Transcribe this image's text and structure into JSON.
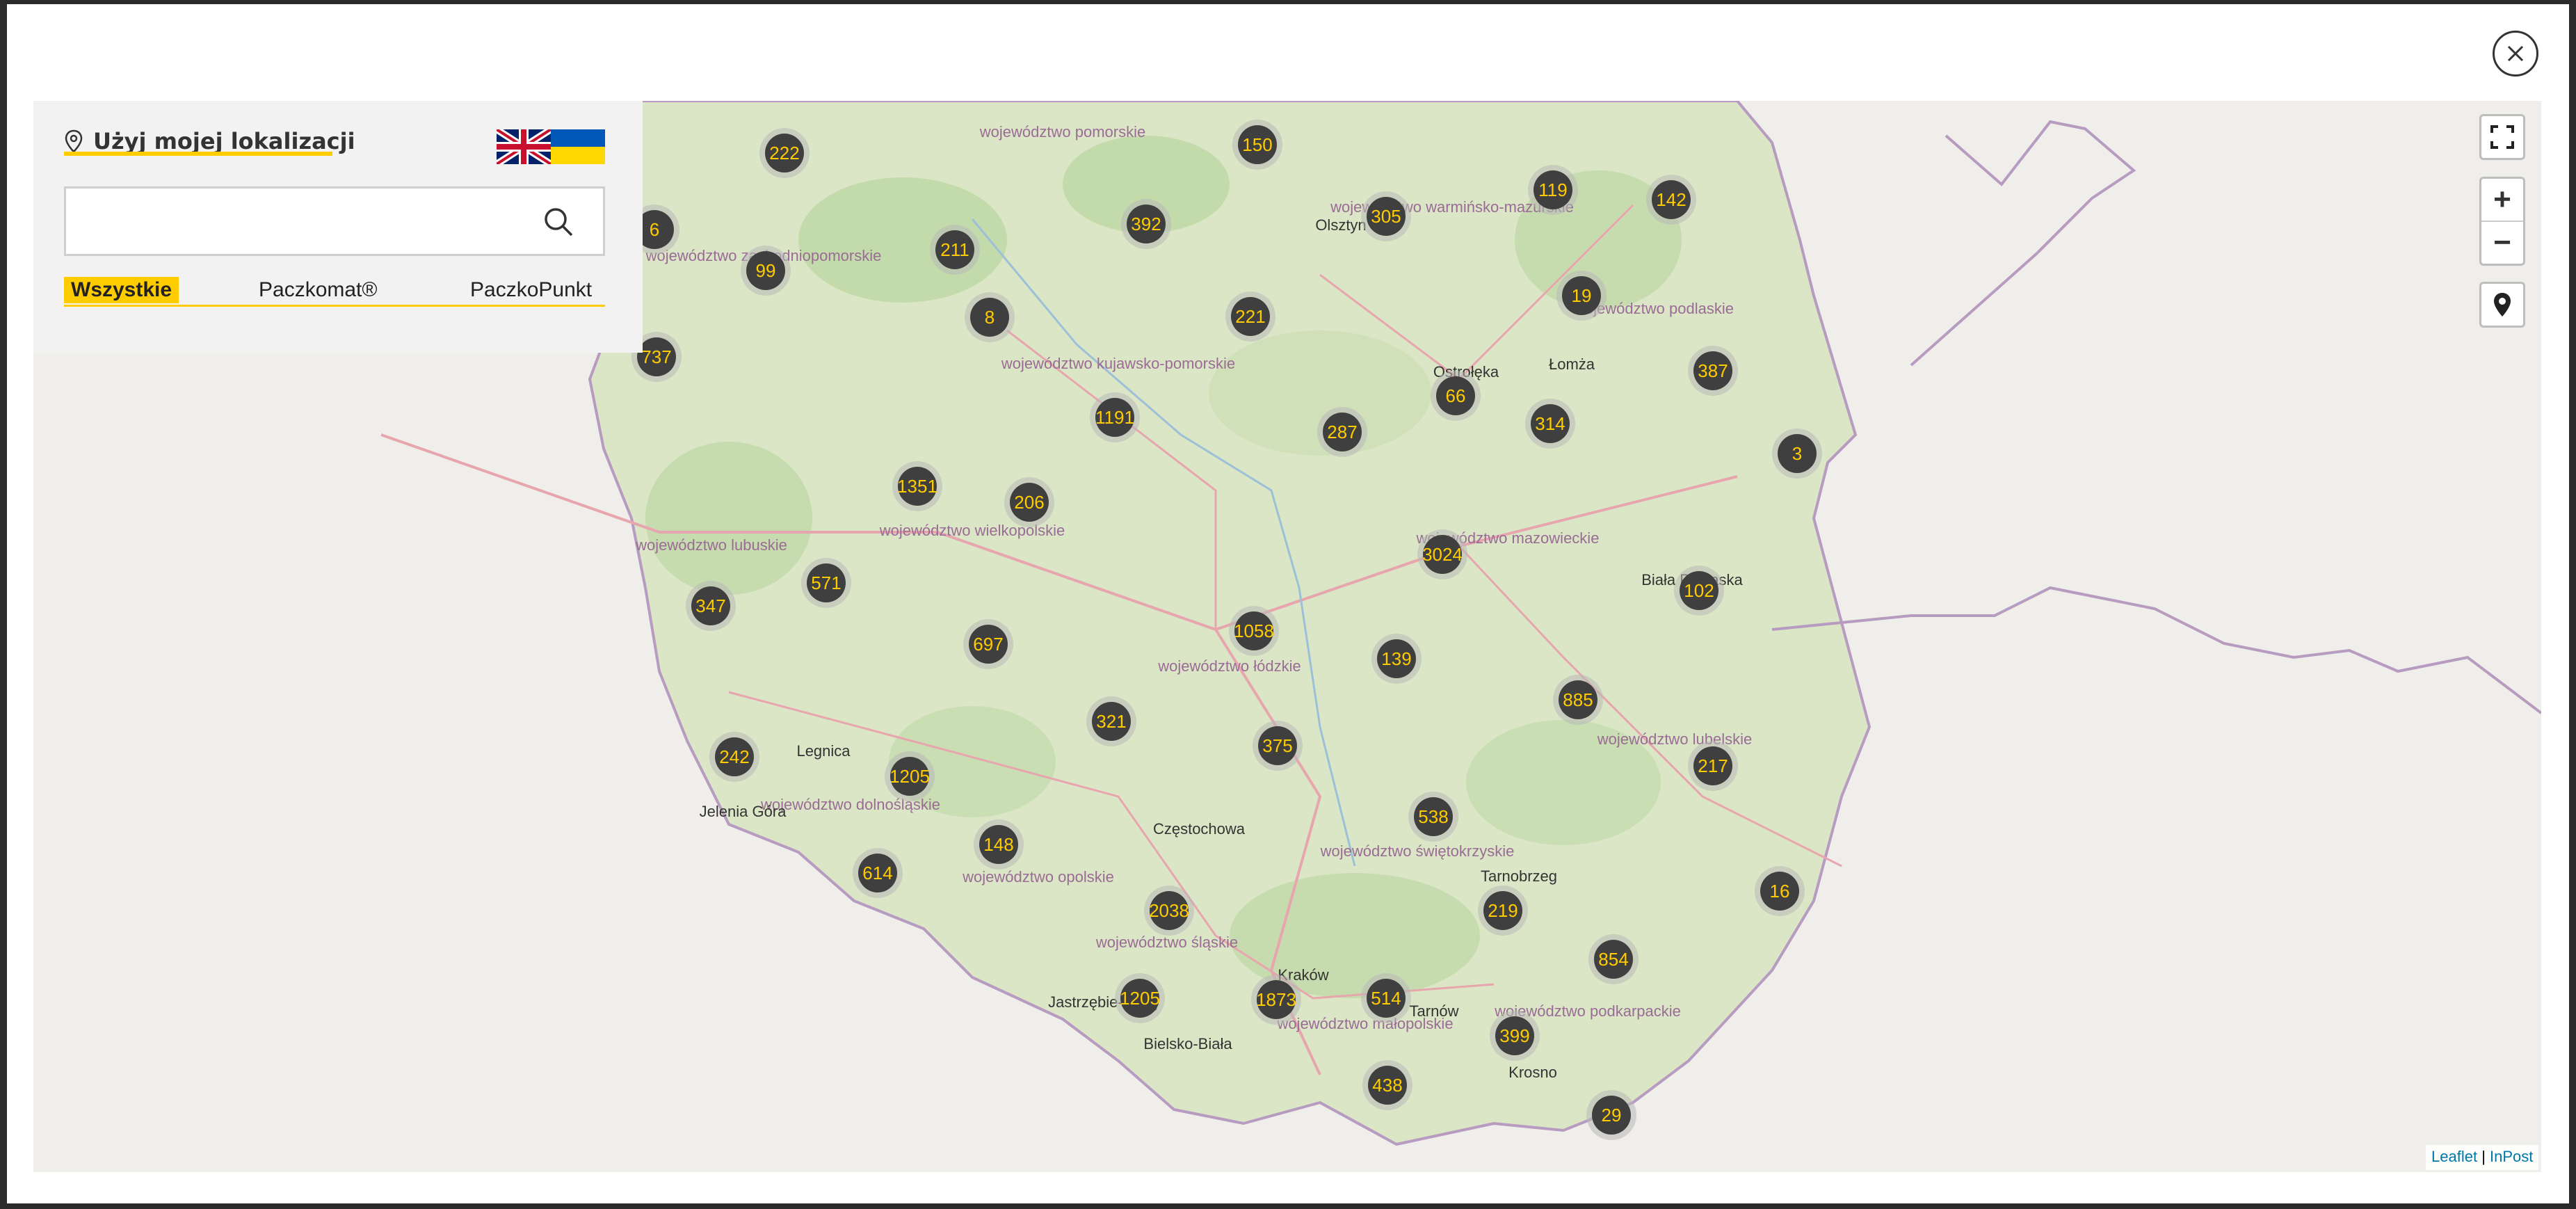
{
  "modal": {
    "close_icon": "close-icon"
  },
  "panel": {
    "use_location_label": "Użyj mojej lokalizacji",
    "location_icon": "map-pin-icon",
    "languages": [
      {
        "name": "English",
        "icon": "flag-uk-icon"
      },
      {
        "name": "Ukrainian",
        "icon": "flag-ukraine-icon"
      }
    ],
    "search": {
      "value": "",
      "placeholder": "",
      "icon": "search-icon"
    },
    "filters": [
      "Wszystkie",
      "Paczkomat®",
      "PaczkoPunkt"
    ],
    "active_filter": "Wszystkie"
  },
  "map_controls": {
    "fullscreen_icon": "fullscreen-icon",
    "zoom_in": "+",
    "zoom_out": "−",
    "locate_icon": "locate-pin-icon"
  },
  "attribution": {
    "leaflet": "Leaflet",
    "separator": "|",
    "inpost": "InPost"
  },
  "colors": {
    "accent": "#ffcc00",
    "cluster_fill": "#3f3f3f",
    "cluster_text": "#ffcc00"
  },
  "region_labels": [
    "województwo pomorskie",
    "województwo warmińsko-mazurskie",
    "województwo zachodniopomorskie",
    "województwo podlaskie",
    "województwo kujawsko-pomorskie",
    "województwo wielkopolskie",
    "województwo lubuskie",
    "województwo mazowieckie",
    "województwo łódzkie",
    "województwo lubelskie",
    "województwo dolnośląskie",
    "województwo opolskie",
    "województwo świętokrzyskie",
    "województwo śląskie",
    "województwo małopolskie",
    "województwo podkarpackie"
  ],
  "city_labels": [
    "Olsztyn",
    "Ostrołęka",
    "Łomża",
    "Biała Podlaska",
    "Legnica",
    "Jelenia Góra",
    "Częstochowa",
    "Tarnobrzeg",
    "Kraków",
    "Tarnów",
    "Krosno",
    "Jastrzębie-Zdrój",
    "Bielsko-Biała"
  ],
  "clusters": [
    "222",
    "150",
    "119",
    "142",
    "392",
    "305",
    "6",
    "211",
    "99",
    "19",
    "8",
    "221",
    "737",
    "387",
    "1191",
    "66",
    "314",
    "287",
    "3",
    "1351",
    "206",
    "3024",
    "571",
    "102",
    "347",
    "1058",
    "697",
    "139",
    "885",
    "321",
    "375",
    "217",
    "242",
    "1205",
    "538",
    "148",
    "614",
    "16",
    "2038",
    "219",
    "854",
    "1205",
    "1873",
    "514",
    "399",
    "438",
    "29"
  ]
}
